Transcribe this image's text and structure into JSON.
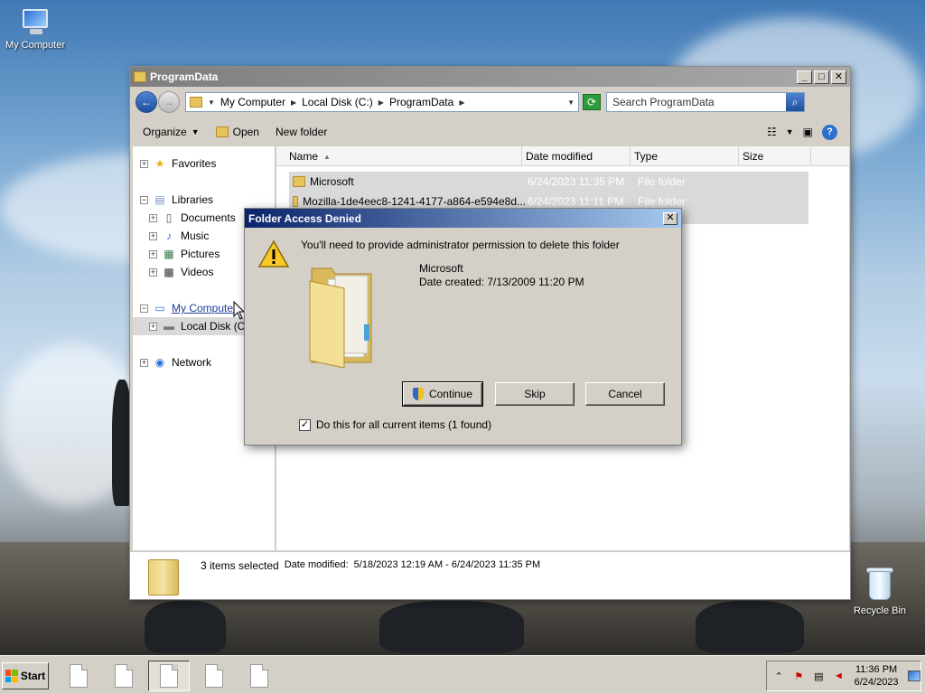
{
  "desktop": {
    "icons": [
      {
        "label": "My Computer"
      },
      {
        "label": "Recycle Bin"
      }
    ]
  },
  "explorer": {
    "title": "ProgramData",
    "breadcrumb": [
      "My Computer",
      "Local Disk (C:)",
      "ProgramData"
    ],
    "search_placeholder": "Search ProgramData",
    "toolbar": {
      "organize": "Organize",
      "open": "Open",
      "new_folder": "New folder"
    },
    "nav_tree": {
      "favorites": "Favorites",
      "libraries": "Libraries",
      "documents": "Documents",
      "music": "Music",
      "pictures": "Pictures",
      "videos": "Videos",
      "my_computer": "My Computer",
      "local_disk": "Local Disk (C:)",
      "network": "Network"
    },
    "columns": {
      "name": "Name",
      "date_modified": "Date modified",
      "type": "Type",
      "size": "Size"
    },
    "files": [
      {
        "name": "Microsoft",
        "date": "6/24/2023 11:35 PM",
        "type": "File folder"
      },
      {
        "name": "Mozilla-1de4eec8-1241-4177-a864-e594e8d...",
        "date": "6/24/2023 11:11 PM",
        "type": "File folder"
      }
    ],
    "details": {
      "selection": "3 items selected",
      "date_label": "Date modified:",
      "date_range": "5/18/2023 12:19 AM - 6/24/2023 11:35 PM"
    }
  },
  "dialog": {
    "title": "Folder Access Denied",
    "message": "You'll need to provide administrator permission to delete this folder",
    "folder_name": "Microsoft",
    "date_created": "Date created: 7/13/2009 11:20 PM",
    "buttons": {
      "continue": "Continue",
      "skip": "Skip",
      "cancel": "Cancel"
    },
    "checkbox_label": "Do this for all current items (1 found)",
    "checkbox_checked": true
  },
  "taskbar": {
    "start": "Start",
    "clock_time": "11:36 PM",
    "clock_date": "6/24/2023"
  }
}
